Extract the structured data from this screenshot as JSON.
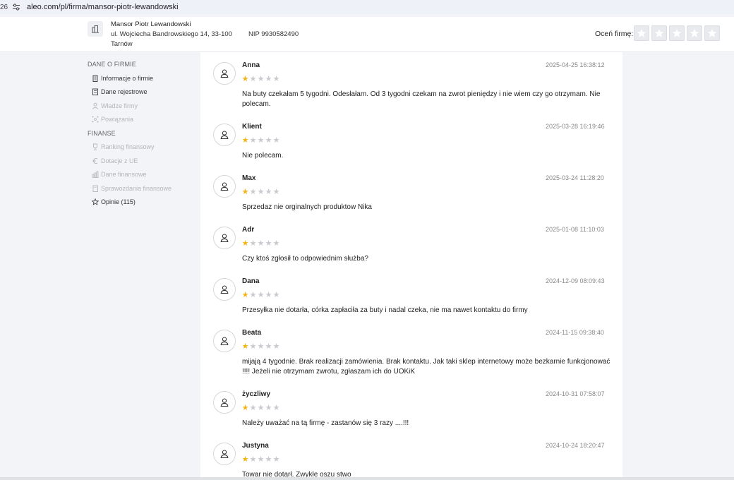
{
  "browser": {
    "tab_fragment": "26",
    "url": "aleo.com/pl/firma/mansor-piotr-lewandowski"
  },
  "company": {
    "name": "Mansor Piotr Lewandowski",
    "address_line1": "ul. Wojciecha Bandrowskiego 14, 33-100",
    "address_line2": "Tarnów",
    "nip": "NIP 9930582490",
    "rate_label": "Oceń firmę:",
    "rate_stars": [
      1,
      2,
      3,
      4,
      5
    ]
  },
  "sidebar": {
    "section_dane": "DANE O FIRMIE",
    "items_dane": [
      {
        "label": "Informacje o firmie",
        "icon": "building-icon",
        "state": "active"
      },
      {
        "label": "Dane rejestrowe",
        "icon": "document-icon",
        "state": "active"
      },
      {
        "label": "Władze firmy",
        "icon": "person-icon",
        "state": "disabled"
      },
      {
        "label": "Powiązania",
        "icon": "network-icon",
        "state": "disabled"
      }
    ],
    "section_finanse": "FINANSE",
    "items_finanse": [
      {
        "label": "Ranking finansowy",
        "icon": "trophy-icon",
        "state": "disabled"
      },
      {
        "label": "Dotacje z UE",
        "icon": "euro-icon",
        "state": "disabled"
      },
      {
        "label": "Dane finansowe",
        "icon": "chart-icon",
        "state": "disabled"
      },
      {
        "label": "Sprawozdania finansowe",
        "icon": "report-icon",
        "state": "disabled"
      },
      {
        "label": "Opinie (115)",
        "icon": "star-icon",
        "state": "active"
      }
    ]
  },
  "colors": {
    "star_on": "#f2b316",
    "star_off": "#c8cacf",
    "page_bg": "#f3f4f7"
  },
  "reviews": [
    {
      "name": "Anna",
      "date": "2025-04-25 16:38:12",
      "rating": 1,
      "text": "Na buty czekałam 5 tygodni. Odesłałam. Od 3 tygodni czekam na zwrot pieniędzy i nie wiem czy go otrzymam. Nie polecam."
    },
    {
      "name": "Klient",
      "date": "2025-03-28 16:19:46",
      "rating": 1,
      "text": "Nie polecam."
    },
    {
      "name": "Max",
      "date": "2025-03-24 11:28:20",
      "rating": 1,
      "text": "Sprzedaz nie orginalnych produktow Nika"
    },
    {
      "name": "Adr",
      "date": "2025-01-08 11:10:03",
      "rating": 1,
      "text": "Czy ktoś zgłosił to odpowiednim służba?"
    },
    {
      "name": "Dana",
      "date": "2024-12-09 08:09:43",
      "rating": 1,
      "text": "Przesyłka nie dotarła, córka zapłaciła za buty i nadal czeka, nie ma nawet kontaktu do firmy"
    },
    {
      "name": "Beata",
      "date": "2024-11-15 09:38:40",
      "rating": 1,
      "text": "mijają 4 tygodnie. Brak realizacji zamówienia. Brak kontaktu. Jak taki sklep internetowy może bezkarnie funkcjonować !!!! Jeżeli nie otrzymam zwrotu, zgłaszam ich do UOKiK"
    },
    {
      "name": "życzliwy",
      "date": "2024-10-31 07:58:07",
      "rating": 1,
      "text": "Należy uważać na tą firmę - zastanów się 3 razy ....!!!"
    },
    {
      "name": "Justyna",
      "date": "2024-10-24 18:20:47",
      "rating": 1,
      "text": "Towar nie dotarł. Zwykłe oszu stwo"
    }
  ]
}
